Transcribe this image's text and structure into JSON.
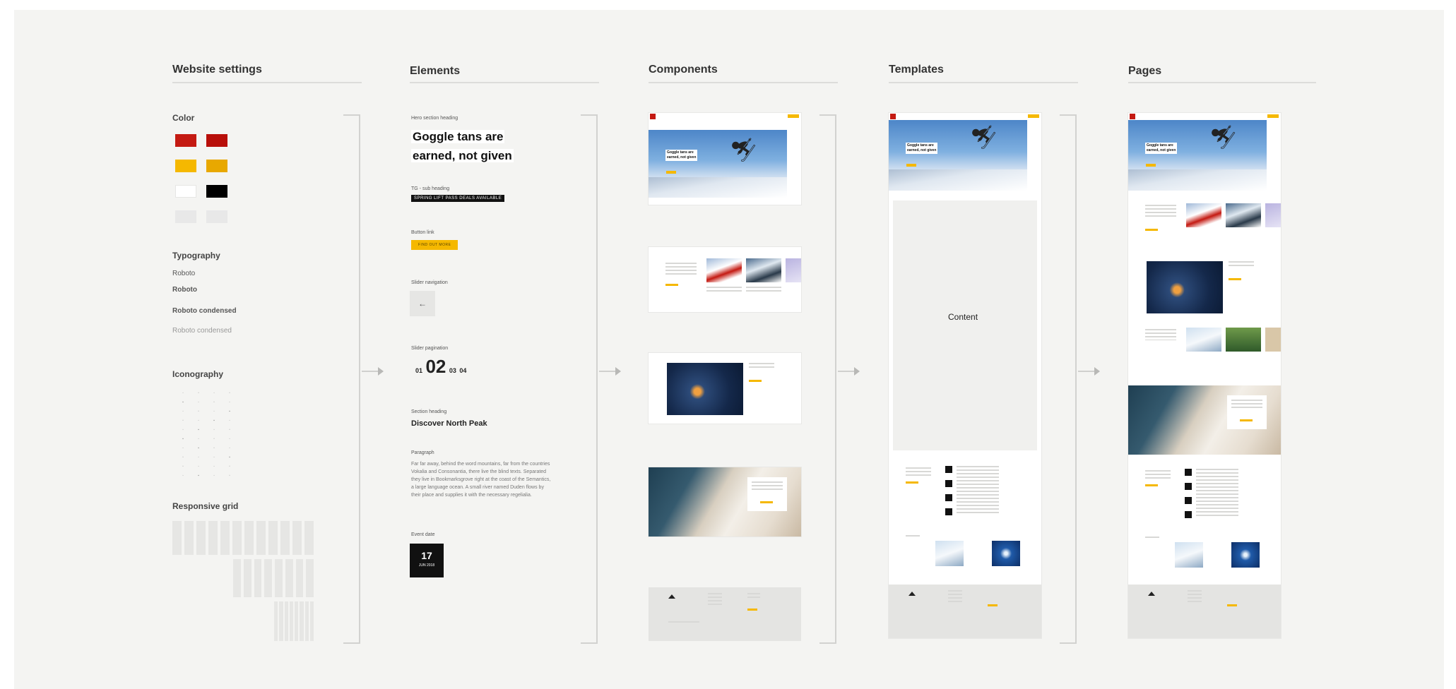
{
  "columns": {
    "website_settings": "Website settings",
    "elements": "Elements",
    "components": "Components",
    "templates": "Templates",
    "pages": "Pages"
  },
  "settings": {
    "color_label": "Color",
    "typography_label": "Typography",
    "iconography_label": "Iconography",
    "grid_label": "Responsive grid",
    "colors": [
      "#c41a12",
      "#b80f0a",
      "#f5b800",
      "#e8a800",
      "#ffffff",
      "#000000",
      "#e8e8e8",
      "#e8e8e8"
    ],
    "fonts": [
      "Roboto",
      "Roboto",
      "Roboto condensed",
      "Roboto condensed"
    ]
  },
  "elements": {
    "hero_label": "Hero section heading",
    "hero_line1": "Goggle tans are",
    "hero_line2": "earned, not given",
    "tag_label": "TG - sub heading",
    "tag_text": "SPRING LIFT PASS DEALS AVAILABLE",
    "button_label": "Button link",
    "button_text": "FIND OUT MORE",
    "slider_nav_label": "Slider navigation",
    "slider_nav_icon": "arrow-left-icon",
    "pagination_label": "Slider pagination",
    "pagination": [
      "01",
      "02",
      "03",
      "04"
    ],
    "section_heading_label": "Section heading",
    "section_heading": "Discover North Peak",
    "paragraph_label": "Paragraph",
    "paragraph": "Far far away, behind the word mountains, far from the countries Vokalia and Consonantia, there live the blind texts. Separated they live in Bookmarksgrove right at the coast of the Semantics, a large language ocean. A small river named Duden flows by their place and supplies it with the necessary regelialia.",
    "event_label": "Event date",
    "event_day": "17",
    "event_month": "JUN 2018"
  },
  "templates": {
    "content_label": "Content"
  },
  "mockup": {
    "hero_line1": "Goggle tans are",
    "hero_line2": "earned, not given"
  }
}
